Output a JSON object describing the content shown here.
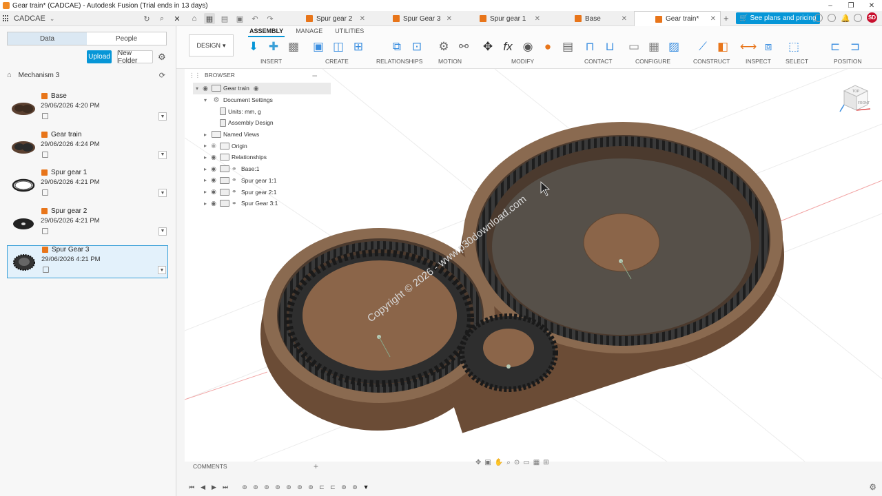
{
  "window": {
    "title": "Gear train* (CADCAE) - Autodesk Fusion (Trial ends in 13 days)",
    "controls": [
      "–",
      "❐",
      "✕"
    ]
  },
  "team": {
    "name": "CADCAE"
  },
  "doc_tabs": [
    {
      "label": "Spur gear 2",
      "active": false
    },
    {
      "label": "Spur Gear 3",
      "active": false
    },
    {
      "label": "Spur gear 1",
      "active": false
    },
    {
      "label": "Base",
      "active": false
    },
    {
      "label": "Gear train*",
      "active": true
    }
  ],
  "plans_button": "See plans and pricing",
  "user_initials": "SD",
  "data_panel": {
    "tabs": [
      "Data",
      "People"
    ],
    "upload": "Upload",
    "new_folder": "New Folder",
    "breadcrumb": "Mechanism 3",
    "files": [
      {
        "name": "Base",
        "date": "29/06/2026 4:20 PM"
      },
      {
        "name": "Gear train",
        "date": "29/06/2026 4:24 PM"
      },
      {
        "name": "Spur gear 1",
        "date": "29/06/2026 4:21 PM"
      },
      {
        "name": "Spur gear 2",
        "date": "29/06/2026 4:21 PM"
      },
      {
        "name": "Spur Gear 3",
        "date": "29/06/2026 4:21 PM",
        "selected": true
      }
    ]
  },
  "toolbar": {
    "workspace": "DESIGN",
    "tabs": [
      "ASSEMBLY",
      "MANAGE",
      "UTILITIES"
    ],
    "groups": [
      "INSERT",
      "CREATE",
      "RELATIONSHIPS",
      "MOTION",
      "MODIFY",
      "CONTACT",
      "CONFIGURE",
      "CONSTRUCT",
      "INSPECT",
      "SELECT",
      "POSITION"
    ]
  },
  "browser": {
    "title": "BROWSER",
    "root": "Gear train",
    "doc_settings": "Document Settings",
    "units": "Units: mm, g",
    "assembly_design": "Assembly Design",
    "named_views": "Named Views",
    "origin": "Origin",
    "relationships": "Relationships",
    "components": [
      "Base:1",
      "Spur gear 1:1",
      "Spur gear 2:1",
      "Spur Gear 3:1"
    ]
  },
  "viewcube": {
    "top": "TOP",
    "front": "FRONT"
  },
  "watermark": "Copyright © 2026 - www.p30download.com",
  "comments_label": "COMMENTS",
  "colors": {
    "accent": "#0696d7",
    "body": "#7a5c43",
    "brand": "#e8751a"
  }
}
